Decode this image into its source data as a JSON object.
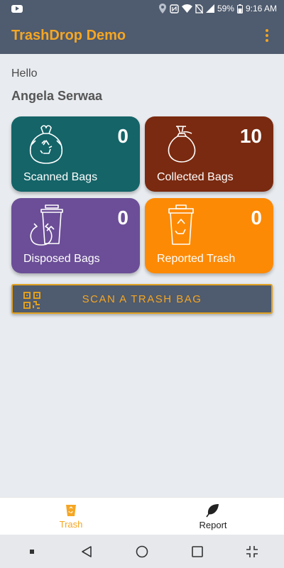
{
  "status_bar": {
    "battery": "59%",
    "time": "9:16 AM"
  },
  "app_bar": {
    "title": "TrashDrop Demo"
  },
  "greeting": "Hello",
  "user_name": "Angela Serwaa",
  "cards": {
    "scanned": {
      "count": "0",
      "label": "Scanned Bags",
      "color": "#146468",
      "icon": "trash-bag-recycle-icon"
    },
    "collected": {
      "count": "10",
      "label": "Collected Bags",
      "color": "#7a2a10",
      "icon": "tied-bag-icon"
    },
    "disposed": {
      "count": "0",
      "label": "Disposed Bags",
      "color": "#6b4e97",
      "icon": "bin-with-bags-icon"
    },
    "reported": {
      "count": "0",
      "label": "Reported Trash",
      "color": "#fd8a04",
      "icon": "recycle-bin-icon"
    }
  },
  "scan_button": {
    "label": "SCAN A TRASH BAG",
    "icon": "qr-code-icon"
  },
  "bottom_nav": {
    "trash": {
      "label": "Trash",
      "active": true,
      "icon": "trash-icon"
    },
    "report": {
      "label": "Report",
      "active": false,
      "icon": "leaf-icon"
    }
  },
  "colors": {
    "accent": "#f5a623",
    "header": "#4f5b6e",
    "background": "#e8ebef"
  }
}
